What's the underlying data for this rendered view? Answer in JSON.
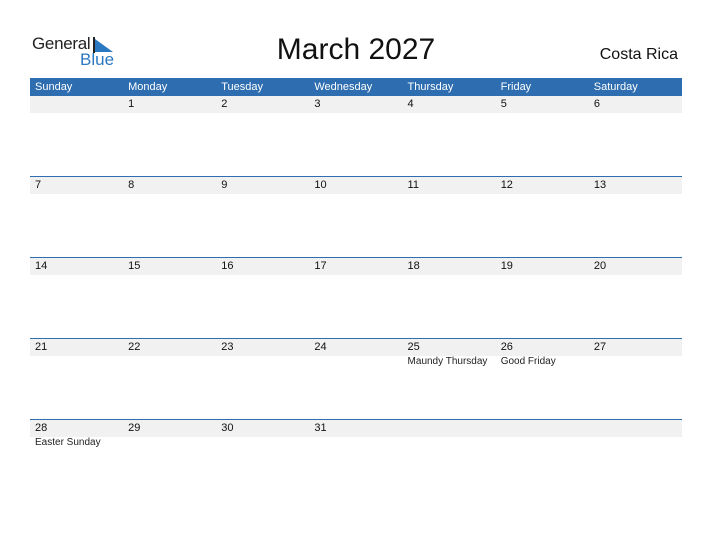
{
  "logo": {
    "general": "General",
    "blue": "Blue"
  },
  "title": "March 2027",
  "country": "Costa Rica",
  "colors": {
    "accent": "#2e6db0",
    "strip": "#f1f1f1"
  },
  "weekdays": [
    "Sunday",
    "Monday",
    "Tuesday",
    "Wednesday",
    "Thursday",
    "Friday",
    "Saturday"
  ],
  "weeks": [
    [
      {
        "d": ""
      },
      {
        "d": "1"
      },
      {
        "d": "2"
      },
      {
        "d": "3"
      },
      {
        "d": "4"
      },
      {
        "d": "5"
      },
      {
        "d": "6"
      }
    ],
    [
      {
        "d": "7"
      },
      {
        "d": "8"
      },
      {
        "d": "9"
      },
      {
        "d": "10"
      },
      {
        "d": "11"
      },
      {
        "d": "12"
      },
      {
        "d": "13"
      }
    ],
    [
      {
        "d": "14"
      },
      {
        "d": "15"
      },
      {
        "d": "16"
      },
      {
        "d": "17"
      },
      {
        "d": "18"
      },
      {
        "d": "19"
      },
      {
        "d": "20"
      }
    ],
    [
      {
        "d": "21"
      },
      {
        "d": "22"
      },
      {
        "d": "23"
      },
      {
        "d": "24"
      },
      {
        "d": "25",
        "e": "Maundy Thursday"
      },
      {
        "d": "26",
        "e": "Good Friday"
      },
      {
        "d": "27"
      }
    ],
    [
      {
        "d": "28",
        "e": "Easter Sunday"
      },
      {
        "d": "29"
      },
      {
        "d": "30"
      },
      {
        "d": "31"
      },
      {
        "d": ""
      },
      {
        "d": ""
      },
      {
        "d": ""
      }
    ]
  ]
}
